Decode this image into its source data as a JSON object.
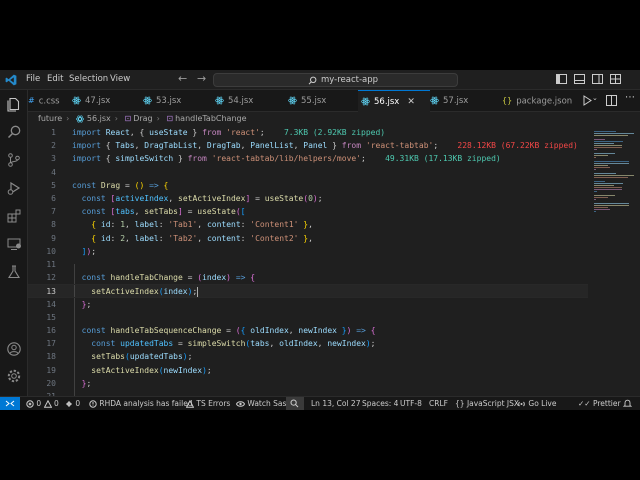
{
  "titlebar": {
    "menus": [
      "File",
      "Edit",
      "Selection",
      "View"
    ],
    "command_center": "my-react-app"
  },
  "tabs": [
    {
      "label": "c.css",
      "active": false
    },
    {
      "label": "47.jsx",
      "active": false
    },
    {
      "label": "53.jsx",
      "active": false
    },
    {
      "label": "54.jsx",
      "active": false
    },
    {
      "label": "55.jsx",
      "active": false
    },
    {
      "label": "56.jsx",
      "active": true
    },
    {
      "label": "57.jsx",
      "active": false
    },
    {
      "label": "package.json",
      "active": false
    }
  ],
  "breadcrumb": [
    "future",
    "56.jsx",
    "Drag",
    "handleTabChange"
  ],
  "editor": {
    "current_line": 13,
    "lines": [
      {
        "n": "1",
        "tokens": [
          [
            "k",
            "import "
          ],
          [
            "v",
            "React"
          ],
          [
            "p",
            ", { "
          ],
          [
            "v",
            "useState"
          ],
          [
            "p",
            " } "
          ],
          [
            "kc",
            "from "
          ],
          [
            "s",
            "'react'"
          ],
          [
            "p",
            ";"
          ]
        ],
        "hint": "7.3KB (2.92KB zipped)",
        "hint_color": "g"
      },
      {
        "n": "2",
        "tokens": [
          [
            "k",
            "import "
          ],
          [
            "p",
            "{ "
          ],
          [
            "v",
            "Tabs"
          ],
          [
            "p",
            ", "
          ],
          [
            "v",
            "DragTabList"
          ],
          [
            "p",
            ", "
          ],
          [
            "v",
            "DragTab"
          ],
          [
            "p",
            ", "
          ],
          [
            "v",
            "PanelList"
          ],
          [
            "p",
            ", "
          ],
          [
            "v",
            "Panel"
          ],
          [
            "p",
            " } "
          ],
          [
            "kc",
            "from "
          ],
          [
            "s",
            "'react-tabtab'"
          ],
          [
            "p",
            ";"
          ]
        ],
        "hint": "228.12KB (67.22KB zipped)",
        "hint_color": "r"
      },
      {
        "n": "3",
        "tokens": [
          [
            "k",
            "import "
          ],
          [
            "p",
            "{ "
          ],
          [
            "v",
            "simpleSwitch"
          ],
          [
            "p",
            " } "
          ],
          [
            "kc",
            "from "
          ],
          [
            "s",
            "'react-tabtab/lib/helpers/move'"
          ],
          [
            "p",
            ";"
          ]
        ],
        "hint": "49.31KB (17.13KB zipped)",
        "hint_color": "g"
      },
      {
        "n": "4",
        "tokens": []
      },
      {
        "n": "5",
        "tokens": [
          [
            "k",
            "const "
          ],
          [
            "f",
            "Drag"
          ],
          [
            "p",
            " = "
          ],
          [
            "br1",
            "("
          ],
          [
            "br1",
            ")"
          ],
          [
            "k",
            " => "
          ],
          [
            "br1",
            "{"
          ]
        ]
      },
      {
        "n": "6",
        "tokens": [
          [
            "p",
            "  "
          ],
          [
            "k",
            "const "
          ],
          [
            "br2",
            "["
          ],
          [
            "c",
            "activeIndex"
          ],
          [
            "p",
            ", "
          ],
          [
            "f",
            "setActiveIndex"
          ],
          [
            "br2",
            "]"
          ],
          [
            "p",
            " = "
          ],
          [
            "f",
            "useState"
          ],
          [
            "br2",
            "("
          ],
          [
            "n",
            "0"
          ],
          [
            "br2",
            ")"
          ],
          [
            "p",
            ";"
          ]
        ]
      },
      {
        "n": "7",
        "tokens": [
          [
            "p",
            "  "
          ],
          [
            "k",
            "const "
          ],
          [
            "br2",
            "["
          ],
          [
            "c",
            "tabs"
          ],
          [
            "p",
            ", "
          ],
          [
            "f",
            "setTabs"
          ],
          [
            "br2",
            "]"
          ],
          [
            "p",
            " = "
          ],
          [
            "f",
            "useState"
          ],
          [
            "br2",
            "("
          ],
          [
            "br3",
            "["
          ]
        ]
      },
      {
        "n": "8",
        "tokens": [
          [
            "p",
            "    "
          ],
          [
            "br1",
            "{ "
          ],
          [
            "v",
            "id"
          ],
          [
            "p",
            ": "
          ],
          [
            "n",
            "1"
          ],
          [
            "p",
            ", "
          ],
          [
            "v",
            "label"
          ],
          [
            "p",
            ": "
          ],
          [
            "s",
            "'Tab1'"
          ],
          [
            "p",
            ", "
          ],
          [
            "v",
            "content"
          ],
          [
            "p",
            ": "
          ],
          [
            "s",
            "'Content1'"
          ],
          [
            "br1",
            " }"
          ],
          [
            "p",
            ","
          ]
        ]
      },
      {
        "n": "9",
        "tokens": [
          [
            "p",
            "    "
          ],
          [
            "br1",
            "{ "
          ],
          [
            "v",
            "id"
          ],
          [
            "p",
            ": "
          ],
          [
            "n",
            "2"
          ],
          [
            "p",
            ", "
          ],
          [
            "v",
            "label"
          ],
          [
            "p",
            ": "
          ],
          [
            "s",
            "'Tab2'"
          ],
          [
            "p",
            ", "
          ],
          [
            "v",
            "content"
          ],
          [
            "p",
            ": "
          ],
          [
            "s",
            "'Content2'"
          ],
          [
            "br1",
            " }"
          ],
          [
            "p",
            ","
          ]
        ]
      },
      {
        "n": "10",
        "tokens": [
          [
            "p",
            "  "
          ],
          [
            "br3",
            "]"
          ],
          [
            "br2",
            ")"
          ],
          [
            "p",
            ";"
          ]
        ]
      },
      {
        "n": "11",
        "tokens": []
      },
      {
        "n": "12",
        "tokens": [
          [
            "p",
            "  "
          ],
          [
            "k",
            "const "
          ],
          [
            "f",
            "handleTabChange"
          ],
          [
            "p",
            " = "
          ],
          [
            "br2",
            "("
          ],
          [
            "v",
            "index"
          ],
          [
            "br2",
            ")"
          ],
          [
            "k",
            " => "
          ],
          [
            "br2",
            "{"
          ]
        ]
      },
      {
        "n": "13",
        "tokens": [
          [
            "p",
            "    "
          ],
          [
            "f",
            "setActiveIndex"
          ],
          [
            "br3",
            "("
          ],
          [
            "v",
            "index"
          ],
          [
            "br3",
            ")"
          ],
          [
            "p",
            ";"
          ]
        ],
        "cursor": true
      },
      {
        "n": "14",
        "tokens": [
          [
            "p",
            "  "
          ],
          [
            "br2",
            "}"
          ],
          [
            "p",
            ";"
          ]
        ]
      },
      {
        "n": "15",
        "tokens": []
      },
      {
        "n": "16",
        "tokens": [
          [
            "p",
            "  "
          ],
          [
            "k",
            "const "
          ],
          [
            "f",
            "handleTabSequenceChange"
          ],
          [
            "p",
            " = "
          ],
          [
            "br2",
            "("
          ],
          [
            "br3",
            "{ "
          ],
          [
            "v",
            "oldIndex"
          ],
          [
            "p",
            ", "
          ],
          [
            "v",
            "newIndex"
          ],
          [
            "br3",
            " }"
          ],
          [
            "br2",
            ")"
          ],
          [
            "k",
            " => "
          ],
          [
            "br2",
            "{"
          ]
        ]
      },
      {
        "n": "17",
        "tokens": [
          [
            "p",
            "    "
          ],
          [
            "k",
            "const "
          ],
          [
            "c",
            "updatedTabs"
          ],
          [
            "p",
            " = "
          ],
          [
            "f",
            "simpleSwitch"
          ],
          [
            "br3",
            "("
          ],
          [
            "v",
            "tabs"
          ],
          [
            "p",
            ", "
          ],
          [
            "v",
            "oldIndex"
          ],
          [
            "p",
            ", "
          ],
          [
            "v",
            "newIndex"
          ],
          [
            "br3",
            ")"
          ],
          [
            "p",
            ";"
          ]
        ]
      },
      {
        "n": "18",
        "tokens": [
          [
            "p",
            "    "
          ],
          [
            "f",
            "setTabs"
          ],
          [
            "br3",
            "("
          ],
          [
            "v",
            "updatedTabs"
          ],
          [
            "br3",
            ")"
          ],
          [
            "p",
            ";"
          ]
        ]
      },
      {
        "n": "19",
        "tokens": [
          [
            "p",
            "    "
          ],
          [
            "f",
            "setActiveIndex"
          ],
          [
            "br3",
            "("
          ],
          [
            "v",
            "newIndex"
          ],
          [
            "br3",
            ")"
          ],
          [
            "p",
            ";"
          ]
        ]
      },
      {
        "n": "20",
        "tokens": [
          [
            "p",
            "  "
          ],
          [
            "br2",
            "}"
          ],
          [
            "p",
            ";"
          ]
        ]
      },
      {
        "n": "21",
        "tokens": []
      }
    ]
  },
  "statusbar": {
    "errors": "0",
    "warnings": "0",
    "ports": "0",
    "rhda": "RHDA analysis has failed",
    "ts_errors": "TS Errors",
    "watch_sass": "Watch Sass",
    "position": "Ln 13, Col 27",
    "spaces": "Spaces: 4",
    "encoding": "UTF-8",
    "eol": "CRLF",
    "language": "JavaScript JSX",
    "golive": "Go Live",
    "prettier": "Prettier"
  },
  "colors": {
    "accent": "#0078d4",
    "editor_bg": "#1f1f1f",
    "chrome_bg": "#181818"
  },
  "icons": [
    "vscode-logo-icon",
    "explorer-icon",
    "search-icon",
    "source-control-icon",
    "run-debug-icon",
    "extensions-icon",
    "remote-explorer-icon",
    "testing-icon",
    "accounts-icon",
    "manage-gear-icon",
    "react-file-icon",
    "css-file-icon",
    "json-file-icon",
    "run-icon",
    "split-editor-icon",
    "more-actions-icon",
    "remote-icon",
    "error-icon",
    "warning-icon",
    "ports-icon",
    "bell-icon"
  ]
}
